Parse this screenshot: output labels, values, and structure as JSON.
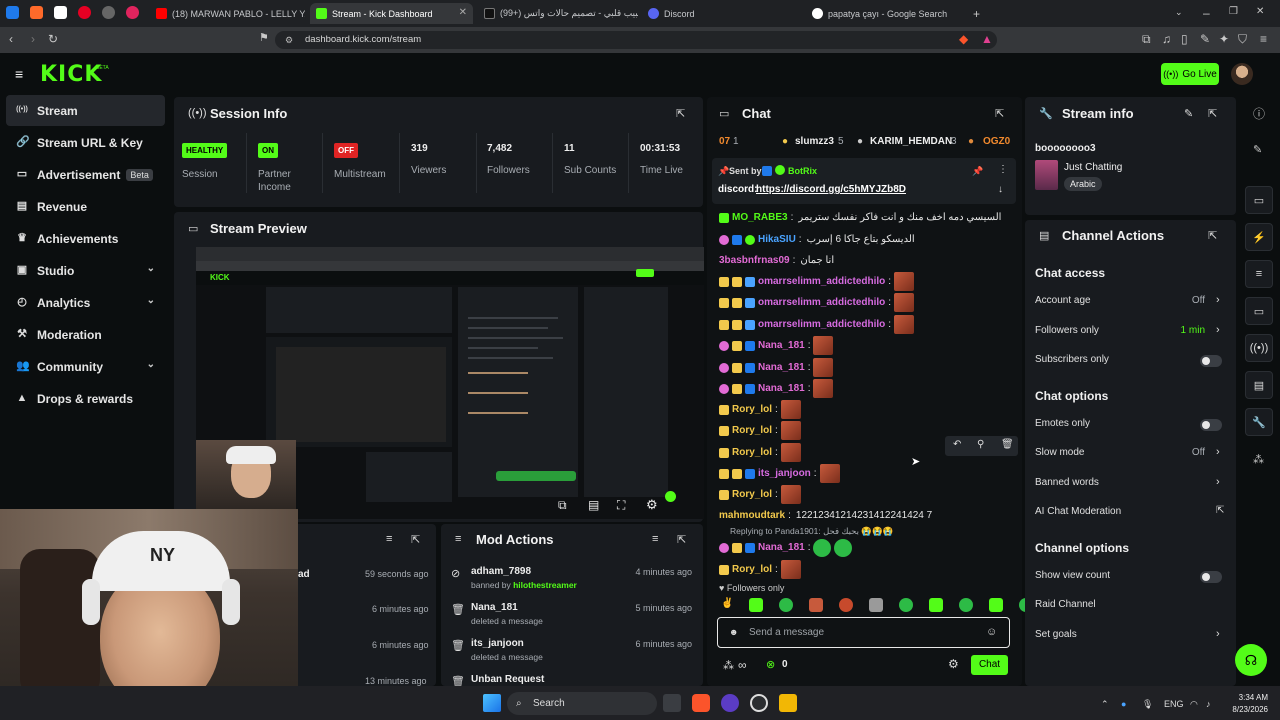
{
  "browser": {
    "tabs": [
      {
        "label": "(18) MARWAN PABLO - LELLY YAH |",
        "icon_color": "#ff0000"
      },
      {
        "label": "Stream - Kick Dashboard",
        "icon_color": "#53fc18"
      },
      {
        "label": "(99+) حبيب قلبي - تصميم حالات واتس",
        "icon_color": "#ffffff"
      },
      {
        "label": "Discord",
        "icon_color": "#5865f2"
      },
      {
        "label": "papatya çayı - Google Search",
        "icon_color": "#ffffff"
      }
    ],
    "url": "dashboard.kick.com/stream"
  },
  "header": {
    "logo": "KICK",
    "logo_beta": "BETA",
    "go_live": "Go Live"
  },
  "sidebar": {
    "items": [
      {
        "label": "Stream",
        "icon": "radio-icon",
        "glyph": "((•))",
        "active": true
      },
      {
        "label": "Stream URL & Key",
        "icon": "link-icon",
        "glyph": "🔗"
      },
      {
        "label": "Advertisement",
        "icon": "tv-icon",
        "glyph": "▭",
        "badge": "Beta"
      },
      {
        "label": "Revenue",
        "icon": "revenue-icon",
        "glyph": "▤"
      },
      {
        "label": "Achievements",
        "icon": "trophy-icon",
        "glyph": "♛"
      },
      {
        "label": "Studio",
        "icon": "studio-icon",
        "glyph": "▣",
        "chevron": true
      },
      {
        "label": "Analytics",
        "icon": "analytics-icon",
        "glyph": "◴",
        "chevron": true
      },
      {
        "label": "Moderation",
        "icon": "hammer-icon",
        "glyph": "⚒"
      },
      {
        "label": "Community",
        "icon": "community-icon",
        "glyph": "👥",
        "chevron": true
      },
      {
        "label": "Drops & rewards",
        "icon": "drops-icon",
        "glyph": "▲"
      }
    ]
  },
  "session": {
    "title": "Session Info",
    "stats": [
      {
        "badge": "HEALTHY",
        "badge_color": "#53fc18",
        "label": "Session"
      },
      {
        "badge": "ON",
        "badge_color": "#53fc18",
        "label": "Partner Income"
      },
      {
        "badge": "OFF",
        "badge_color": "#e02424",
        "label": "Multistream"
      },
      {
        "value": "319",
        "label": "Viewers"
      },
      {
        "value": "7,482",
        "label": "Followers"
      },
      {
        "value": "11",
        "label": "Sub Counts"
      },
      {
        "value": "00:31:53",
        "label": "Time Live"
      }
    ]
  },
  "preview": {
    "title": "Stream Preview"
  },
  "mod_actions": {
    "title": "Mod Actions",
    "left_partial": [
      {
        "text": "ad",
        "time": "59 seconds ago"
      },
      {
        "text": "",
        "time": "6 minutes ago"
      },
      {
        "text": "",
        "time": "6 minutes ago"
      },
      {
        "text": "",
        "time": "13 minutes ago"
      }
    ],
    "items": [
      {
        "user": "adham_7898",
        "action": "banned by",
        "by": "hilothestreamer",
        "time": "4 minutes ago",
        "icon": "ban-icon",
        "glyph": "⊘"
      },
      {
        "user": "Nana_181",
        "action": "deleted a message",
        "time": "5 minutes ago",
        "icon": "trash-icon",
        "glyph": "🗑"
      },
      {
        "user": "its_janjoon",
        "action": "deleted a message",
        "time": "6 minutes ago",
        "icon": "trash-icon",
        "glyph": "🗑"
      },
      {
        "user": "Unban Request",
        "action": "",
        "time": "",
        "icon": "trash-icon",
        "glyph": "🗑"
      }
    ]
  },
  "chat": {
    "title": "Chat",
    "leaderboard": [
      {
        "rank": "07",
        "value": "1"
      },
      {
        "name": "slumzz3",
        "value": "5"
      },
      {
        "name": "KARIM_HEMDAN",
        "value": "3"
      },
      {
        "name": "OGZ0",
        "value": ""
      }
    ],
    "pinned": {
      "sent_by": "Sent by",
      "bot": "BotRix",
      "message_prefix": "discord:",
      "link": "https://discord.gg/c5hMYJZb8D"
    },
    "messages": [
      {
        "user": "MO_RABE3",
        "color": "#53fc18",
        "text": "السيسي دمه اخف منك و انت فاكر نفسك ستريمر",
        "badges": [
          "mod"
        ]
      },
      {
        "user": "HikaSIU",
        "color": "#4aa3ff",
        "text": "الديسكو بتاع جاكا 6 إسرب",
        "badges": [
          "sub",
          "bot",
          "verified"
        ]
      },
      {
        "user": "3basbnfrnas09",
        "color": "#e26bd5",
        "text": "انا جمان",
        "badges": []
      },
      {
        "user": "omarrselimm_addictedhilo",
        "color": "#d66be0",
        "text": "",
        "emote": true,
        "badges": [
          "founder",
          "crown",
          "vip"
        ]
      },
      {
        "user": "omarrselimm_addictedhilo",
        "color": "#d66be0",
        "text": "",
        "emote": true,
        "badges": [
          "founder",
          "crown",
          "vip"
        ]
      },
      {
        "user": "omarrselimm_addictedhilo",
        "color": "#d66be0",
        "text": "",
        "emote": true,
        "badges": [
          "founder",
          "crown",
          "vip"
        ]
      },
      {
        "user": "Nana_181",
        "color": "#e26bd5",
        "text": "",
        "emote": true,
        "badges": [
          "sub",
          "crown",
          "bot"
        ]
      },
      {
        "user": "Nana_181",
        "color": "#e26bd5",
        "text": "",
        "emote": true,
        "badges": [
          "sub",
          "crown",
          "bot"
        ]
      },
      {
        "user": "Nana_181",
        "color": "#e26bd5",
        "text": "",
        "emote": true,
        "badges": [
          "sub",
          "crown",
          "bot"
        ]
      },
      {
        "user": "Rory_lol",
        "color": "#f2c94c",
        "text": "",
        "emote": true,
        "badges": [
          "founder"
        ]
      },
      {
        "user": "Rory_lol",
        "color": "#f2c94c",
        "text": "",
        "emote": true,
        "badges": [
          "founder"
        ]
      },
      {
        "user": "Rory_lol",
        "color": "#f2c94c",
        "text": "",
        "emote": true,
        "badges": [
          "founder"
        ]
      },
      {
        "user": "its_janjoon",
        "color": "#d66be0",
        "text": "",
        "emote": true,
        "badges": [
          "founder",
          "crown",
          "bot"
        ]
      },
      {
        "user": "Rory_lol",
        "color": "#f2c94c",
        "text": "",
        "emote": true,
        "badges": [
          "founder"
        ]
      },
      {
        "user": "mahmoudtark",
        "color": "#f2c94c",
        "text": "12212341214231412241424 7",
        "badges": []
      },
      {
        "reply": "Replying to Panda1901: بحبك فحل 😭😭😭"
      },
      {
        "user": "Nana_181",
        "color": "#e26bd5",
        "text": "",
        "green_emotes": true,
        "badges": [
          "sub",
          "crown",
          "bot"
        ]
      },
      {
        "user": "Rory_lol",
        "color": "#f2c94c",
        "text": "",
        "emote": true,
        "badges": [
          "founder"
        ]
      }
    ],
    "followers_only": "Followers only",
    "input_placeholder": "Send a message",
    "points": "0",
    "send_button": "Chat"
  },
  "stream_info": {
    "title": "Stream info",
    "stream_title": "boooooooo3",
    "category": "Just Chatting",
    "language": "Arabic"
  },
  "channel_actions": {
    "title": "Channel Actions",
    "sections": [
      {
        "heading": "Chat access",
        "items": [
          {
            "label": "Account age",
            "value": "Off",
            "control": "chevron"
          },
          {
            "label": "Followers only",
            "value": "1 min",
            "value_color": "#53fc18",
            "control": "chevron"
          },
          {
            "label": "Subscribers only",
            "control": "toggle"
          }
        ]
      },
      {
        "heading": "Chat options",
        "items": [
          {
            "label": "Emotes only",
            "control": "toggle"
          },
          {
            "label": "Slow mode",
            "value": "Off",
            "control": "chevron"
          },
          {
            "label": "Banned words",
            "control": "chevron"
          },
          {
            "label": "AI Chat Moderation",
            "control": "external"
          }
        ]
      },
      {
        "heading": "Channel options",
        "items": [
          {
            "label": "Show view count",
            "control": "toggle"
          },
          {
            "label": "Raid Channel",
            "control": "none"
          },
          {
            "label": "Set goals",
            "control": "chevron"
          }
        ]
      }
    ]
  },
  "taskbar": {
    "search": "Search",
    "language": "ENG",
    "time": "3:34 AM",
    "date": "8/23/2026"
  },
  "colors": {
    "accent": "#53fc18",
    "panel_bg": "#181b1f",
    "page_bg": "#0b0e0f"
  }
}
